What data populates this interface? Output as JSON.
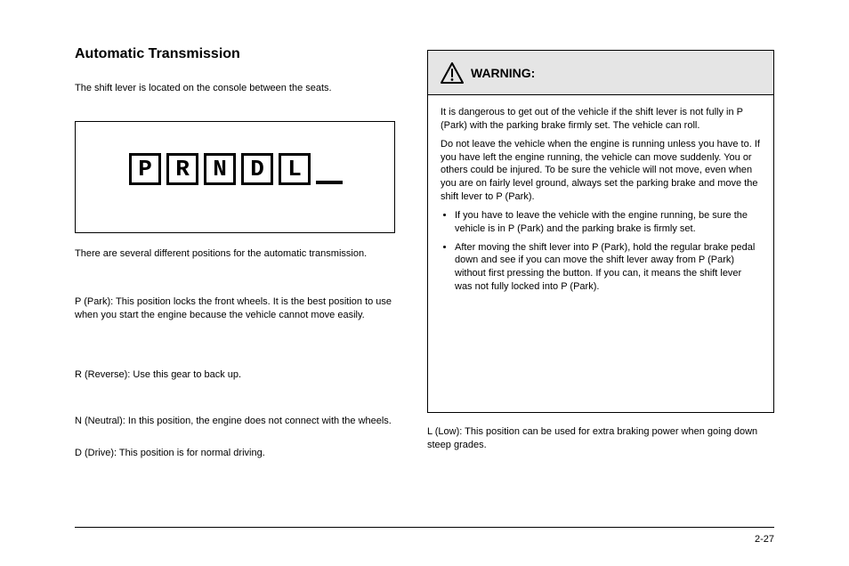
{
  "heading": "Automatic Transmission",
  "intro": "The shift lever is located on the console between the seats.",
  "prndl": [
    "P",
    "R",
    "N",
    "D",
    "L"
  ],
  "left": {
    "t1": "There are several different positions for the automatic transmission.",
    "t2": "P (Park): This position locks the front wheels. It is the best position to use when you start the engine because the vehicle cannot move easily.",
    "t3": "R (Reverse): Use this gear to back up.",
    "t4": "N (Neutral): In this position, the engine does not connect with the wheels.",
    "t5": "D (Drive): This position is for normal driving."
  },
  "warning": {
    "title": "WARNING:",
    "body_lead": "It is dangerous to get out of the vehicle if the shift lever is not fully in P (Park) with the parking brake firmly set. The vehicle can roll.",
    "body_mid": "Do not leave the vehicle when the engine is running unless you have to. If you have left the engine running, the vehicle can move suddenly. You or others could be injured. To be sure the vehicle will not move, even when you are on fairly level ground, always set the parking brake and move the shift lever to P (Park).",
    "items": [
      "If you have to leave the vehicle with the engine running, be sure the vehicle is in P (Park) and the parking brake is firmly set.",
      "After moving the shift lever into P (Park), hold the regular brake pedal down and see if you can move the shift lever away from P (Park) without first pressing the button. If you can, it means the shift lever was not fully locked into P (Park)."
    ]
  },
  "right": {
    "r1": "L (Low): This position can be used for extra braking power when going down steep grades."
  },
  "page_number": "2-27"
}
